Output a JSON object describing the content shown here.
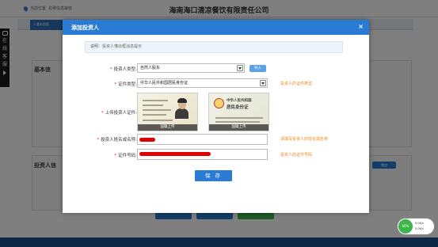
{
  "page": {
    "location_label": "当前位置",
    "location_path": "名称信息审核",
    "company_name": "海南海口清凉餐饮有限责任公司",
    "tab_label": "1.基本信息",
    "section_basic": "基本信",
    "section_investor": "投资人信",
    "add_button_bg": "增加",
    "side_chat": [
      "在",
      "线",
      "客",
      "服"
    ]
  },
  "modal": {
    "title": "添加投资人",
    "close_glyph": "×",
    "note_label": "说明：",
    "note_text": "投资人懂出框消息提示",
    "fields": {
      "investor_type": {
        "label": "投资人类型:",
        "value": "自然人股东",
        "import_label": "导入"
      },
      "cert_type": {
        "label": "证件类型:",
        "value": "中华人民共和国居民身份证",
        "hint": "投资人的证件类型"
      },
      "upload": {
        "label": "上传投资人证件:",
        "front_caption": "国徽上传",
        "back_caption": "国徽上传",
        "back_line1": "中华人民共和国",
        "back_line2": "居民身份证"
      },
      "name": {
        "label": "投资人姓名或名称:",
        "hint": "请填写投资人的姓名或名称"
      },
      "cert_no": {
        "label": "证件号码:",
        "hint": "投资人的证件号码"
      }
    },
    "save_label": "保 存"
  },
  "speed_widget": {
    "percent": "66%",
    "up": "0.0K/s",
    "down": "0.0K/s"
  },
  "colors": {
    "accent": "#2a7bd3",
    "hint": "#f0891e",
    "required": "#e02020",
    "redaction": "#e00000"
  }
}
